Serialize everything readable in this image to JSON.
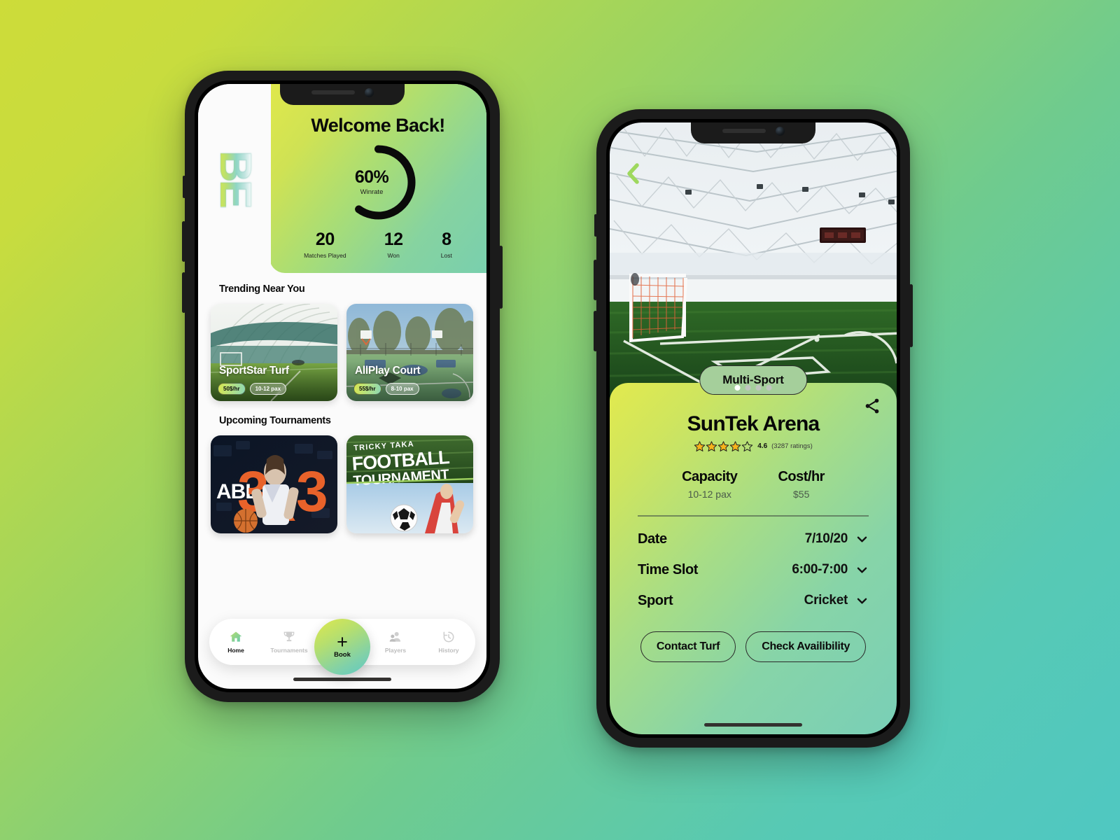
{
  "background": {
    "from": "#cddc39",
    "to": "#4fc8c2"
  },
  "left_phone": {
    "logo_text": "BE",
    "hero": {
      "title": "Welcome Back!",
      "winrate_value": "60%",
      "winrate_label": "Winrate",
      "winrate_percent": 60,
      "stats": [
        {
          "num": "20",
          "label": "Matches Played"
        },
        {
          "num": "12",
          "label": "Won"
        },
        {
          "num": "8",
          "label": "Lost"
        }
      ]
    },
    "trending": {
      "title": "Trending Near You",
      "cards": [
        {
          "name": "SportStar Turf",
          "price": "50$/hr",
          "pax": "10-12 pax",
          "image": "indoor-turf-dome"
        },
        {
          "name": "AllPlay Court",
          "price": "55$/hr",
          "pax": "8-10 pax",
          "image": "outdoor-basketball-court"
        }
      ]
    },
    "tournaments": {
      "title": "Upcoming Tournaments",
      "cards": [
        {
          "brand": "ABL",
          "big": "3",
          "x": "X",
          "big2": "3",
          "image": "basketball-3x3-poster"
        },
        {
          "kicker": "TRICKY TAKA",
          "line1": "FOOTBALL",
          "line2": "TOURNAMENT",
          "image": "football-tournament-poster"
        }
      ]
    },
    "tabbar": {
      "items": [
        {
          "label": "Home",
          "icon": "home-icon",
          "active": true
        },
        {
          "label": "Tournaments",
          "icon": "trophy-icon",
          "active": false
        },
        {
          "label": "Players",
          "icon": "players-icon",
          "active": false
        },
        {
          "label": "History",
          "icon": "history-icon",
          "active": false
        }
      ],
      "fab": {
        "label": "Book",
        "icon": "plus-icon"
      }
    }
  },
  "right_phone": {
    "photo": {
      "alt": "indoor-soccer-field",
      "carousel_dots": 4,
      "active_dot": 0
    },
    "back_icon": "back-chevron-icon",
    "share_icon": "share-icon",
    "pill_label": "Multi-Sport",
    "venue_name": "SunTek Arena",
    "rating": {
      "value": "4.6",
      "stars_filled": 4,
      "stars_total": 5,
      "count": "(3287 ratings)"
    },
    "specs": [
      {
        "key": "Capacity",
        "value": "10-12 pax"
      },
      {
        "key": "Cost/hr",
        "value": "$55"
      }
    ],
    "form_rows": [
      {
        "key": "Date",
        "value": "7/10/20",
        "icon": "chevron-down-icon"
      },
      {
        "key": "Time Slot",
        "value": "6:00-7:00",
        "icon": "chevron-down-icon"
      },
      {
        "key": "Sport",
        "value": "Cricket",
        "icon": "chevron-down-icon"
      }
    ],
    "actions": [
      {
        "label": "Contact Turf"
      },
      {
        "label": "Check Availibility"
      }
    ]
  }
}
